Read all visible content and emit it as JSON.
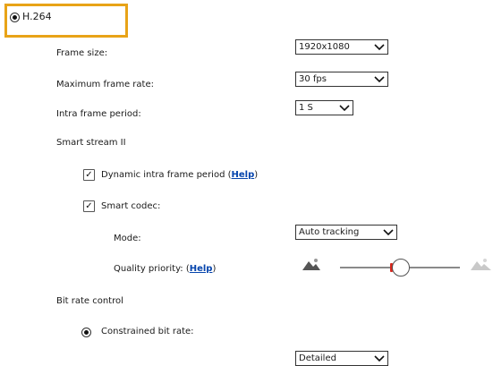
{
  "codec": {
    "h264_label": "H.264",
    "selected": true
  },
  "frame_size": {
    "label": "Frame size:",
    "value": "1920x1080"
  },
  "max_frame_rate": {
    "label": "Maximum frame rate:",
    "value": "30 fps"
  },
  "intra_frame_period": {
    "label": "Intra frame period:",
    "value": "1 S"
  },
  "smart_stream": {
    "heading": "Smart stream II",
    "dynamic_intra": {
      "label": "Dynamic intra frame period (",
      "help": "Help",
      "close": ")",
      "checked": true
    },
    "smart_codec": {
      "label": "Smart codec:",
      "checked": true
    },
    "mode": {
      "label": "Mode:",
      "value": "Auto tracking"
    },
    "quality_priority": {
      "label": "Quality priority: (",
      "help": "Help",
      "close": ")",
      "slider_position": 0.42
    }
  },
  "bit_rate_control": {
    "heading": "Bit rate control",
    "constrained": {
      "label": "Constrained bit rate:",
      "selected": true
    },
    "detail_select": {
      "value": "Detailed"
    }
  },
  "colors": {
    "highlight": "#e8a317",
    "link": "#0645ad",
    "slider_accent": "#d9261c"
  }
}
